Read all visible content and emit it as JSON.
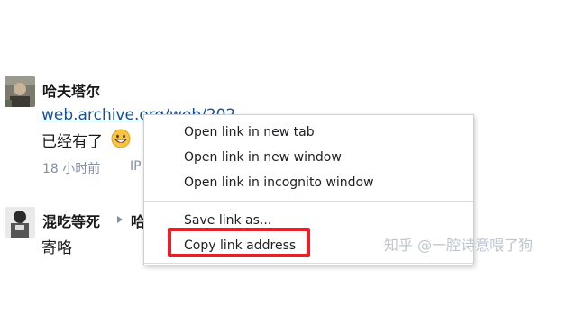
{
  "comment1": {
    "author": "哈夫塔尔",
    "link_text": "web.archive.org/web/202",
    "text": "已经有了",
    "time": "18 小时前",
    "meta_extra": "IP"
  },
  "comment2": {
    "author": "混吃等死",
    "reply_to": "哈",
    "text": "寄咯"
  },
  "context_menu": {
    "items": [
      "Open link in new tab",
      "Open link in new window",
      "Open link in incognito window",
      "Save link as...",
      "Copy link address"
    ],
    "highlighted_item": "Copy link address",
    "highlight_color": "#e8202a"
  },
  "watermark": "知乎 @一腔诗意喂了狗",
  "colors": {
    "link": "#175199",
    "meta": "#8590a6",
    "text": "#1a1a1a"
  }
}
